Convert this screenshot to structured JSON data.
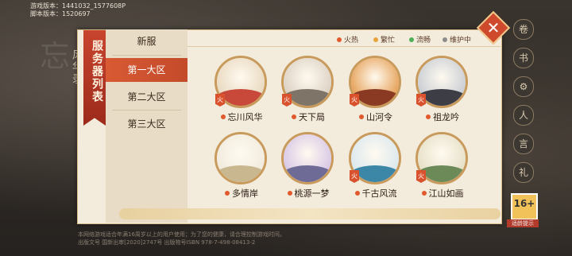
{
  "version": {
    "game_version": "游戏版本：1441032_1577608P",
    "script_version": "脚本版本：1520697"
  },
  "side_title": "风华录",
  "panel_title": "服务器列表",
  "tabs": [
    {
      "label": "新服",
      "active": false
    },
    {
      "label": "第一大区",
      "active": true
    },
    {
      "label": "第二大区",
      "active": false
    },
    {
      "label": "第三大区",
      "active": false
    }
  ],
  "legend": [
    {
      "label": "火热",
      "color": "#e05a2b"
    },
    {
      "label": "繁忙",
      "color": "#e8a23a"
    },
    {
      "label": "流畅",
      "color": "#4fae58"
    },
    {
      "label": "维护中",
      "color": "#8c8c8c"
    }
  ],
  "servers": [
    {
      "name": "忘川风华",
      "status_color": "#e05a2b",
      "badge": "火",
      "sky": "#e9d9c0",
      "hill": "#c8493a"
    },
    {
      "name": "天下局",
      "status_color": "#e05a2b",
      "badge": "火",
      "sky": "#dcd2c4",
      "hill": "#7f7468"
    },
    {
      "name": "山河令",
      "status_color": "#e05a2b",
      "badge": "火",
      "sky": "#e6a25a",
      "hill": "#8a3a22"
    },
    {
      "name": "祖龙吟",
      "status_color": "#e05a2b",
      "badge": "火",
      "sky": "#c9cdd3",
      "hill": "#3c3d45"
    },
    {
      "name": "多情岸",
      "status_color": "#e05a2b",
      "badge": "",
      "sky": "#f1ebde",
      "hill": "#c9b78f"
    },
    {
      "name": "桃源一梦",
      "status_color": "#e05a2b",
      "badge": "",
      "sky": "#d8c7e6",
      "hill": "#6e6c96"
    },
    {
      "name": "千古风流",
      "status_color": "#e05a2b",
      "badge": "火",
      "sky": "#dbe8ee",
      "hill": "#3c86a8"
    },
    {
      "name": "江山如画",
      "status_color": "#e05a2b",
      "badge": "火",
      "sky": "#e6e0c8",
      "hill": "#6b8a58"
    }
  ],
  "age_rating": {
    "value": "16+",
    "label": "适龄提示"
  },
  "copyright": [
    "本网络游戏适合年满16周岁以上的用户使用；为了您的健康，请合理控制游戏时间。",
    "出版文号 国新出审[2020]2747号 出版物号ISBN 978-7-498-08413-2"
  ],
  "icons": {
    "close": "close-icon",
    "right": [
      "scroll-icon",
      "book-icon",
      "gear-icon",
      "user-icon",
      "chat-icon",
      "gift-icon"
    ]
  }
}
